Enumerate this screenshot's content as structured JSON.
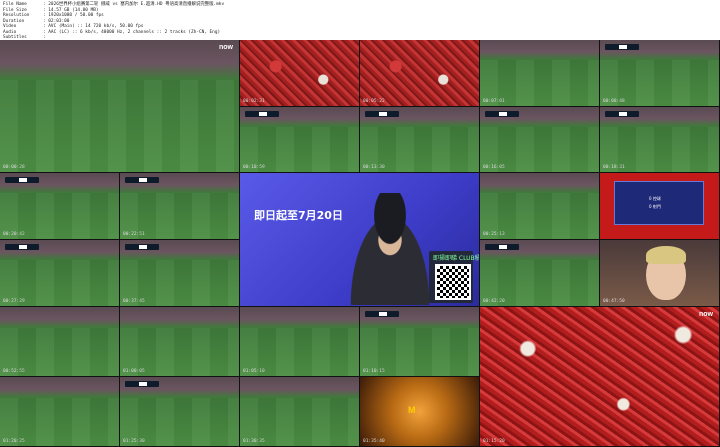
{
  "header": {
    "rows": [
      {
        "key": "File Name",
        "value": ": 2026世界杯小组赛第二轮 挪威 vs 塞内加尔 E.超清.HD 粤语高清直播解说完整版.mkv"
      },
      {
        "key": "File Size",
        "value": ": 14.57 GB (14.00 MB)"
      },
      {
        "key": "Resolution",
        "value": ": 1920x1080 / 50.00 fps"
      },
      {
        "key": "Duration",
        "value": ": 02:03:00"
      },
      {
        "key": "Video",
        "value": ": AVC (Main) :: 14 720 kb/s, 50.00 fps"
      },
      {
        "key": "Audio",
        "value": ": AAC (LC) :: 6 kb/s, 48000 Hz, 2 channels :: 2 tracks (Zh-CN, Eng)"
      },
      {
        "key": "Subtitles",
        "value": ":"
      }
    ]
  },
  "tiles": [
    {
      "name": "tile-01",
      "ts": "00:00:28"
    },
    {
      "name": "tile-02",
      "ts": "00:02:31"
    },
    {
      "name": "tile-03",
      "ts": "00:05:22"
    },
    {
      "name": "tile-04",
      "ts": "00:07:01"
    },
    {
      "name": "tile-05",
      "ts": "00:08:48"
    },
    {
      "name": "tile-06",
      "ts": "00:10:59"
    },
    {
      "name": "tile-07",
      "ts": "00:13:30"
    },
    {
      "name": "tile-08",
      "ts": "00:16:05"
    },
    {
      "name": "tile-09",
      "ts": "00:18:31"
    },
    {
      "name": "tile-10",
      "ts": "00:20:42"
    },
    {
      "name": "tile-11",
      "ts": "00:22:51"
    },
    {
      "name": "tile-12",
      "ts": "00:25:13"
    },
    {
      "name": "tile-13",
      "ts": "00:27:29"
    },
    {
      "name": "tile-14",
      "ts": "00:37:45"
    },
    {
      "name": "tile-15",
      "ts": "00:42:20"
    },
    {
      "name": "tile-16",
      "ts": "00:47:50"
    },
    {
      "name": "tile-17",
      "ts": "00:52:55"
    },
    {
      "name": "tile-18",
      "ts": "01:00:05"
    },
    {
      "name": "tile-19",
      "ts": "01:05:10"
    },
    {
      "name": "tile-20",
      "ts": "01:10:15"
    },
    {
      "name": "tile-21",
      "ts": "01:15:20"
    },
    {
      "name": "tile-22",
      "ts": "01:20:25"
    },
    {
      "name": "tile-23",
      "ts": "01:25:30"
    },
    {
      "name": "tile-24",
      "ts": "01:30:35"
    },
    {
      "name": "tile-25",
      "ts": "01:35:40"
    },
    {
      "name": "tile-26",
      "ts": "01:40:45"
    },
    {
      "name": "tile-27",
      "ts": "01:45:50"
    },
    {
      "name": "tile-28",
      "ts": "01:50:55"
    },
    {
      "name": "tile-29",
      "ts": "01:56:00"
    }
  ],
  "promo": {
    "headline": "即日起至7月20日",
    "qr_label": "即掃即睇 CLUB積分"
  },
  "brand": {
    "now": "now"
  },
  "stats": {
    "row1": "0    控球",
    "row2": "0    射門"
  }
}
